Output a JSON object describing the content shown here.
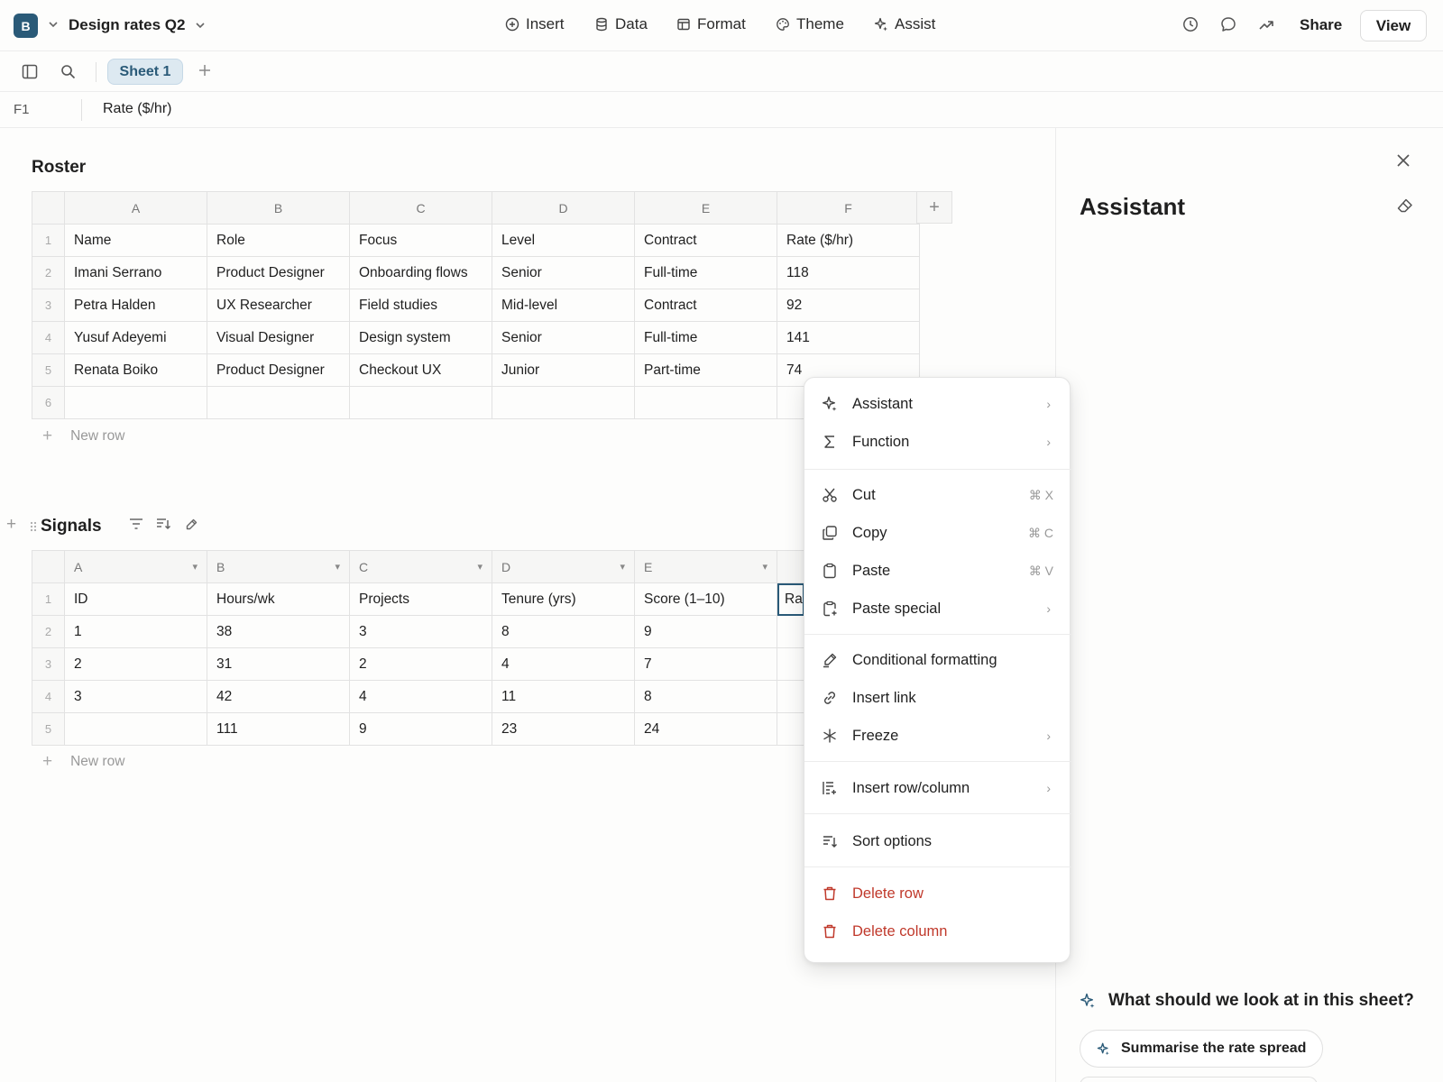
{
  "app": {
    "logo_letter": "B",
    "doc_title": "Design rates Q2"
  },
  "menus": {
    "insert": "Insert",
    "data": "Data",
    "format": "Format",
    "theme": "Theme",
    "assist": "Assist"
  },
  "toolbar": {
    "share": "Share",
    "view": "View"
  },
  "tabs": {
    "active": "Sheet 1"
  },
  "formula_bar": {
    "cell_ref": "F1",
    "value": "Rate ($/hr)"
  },
  "roster": {
    "title": "Roster",
    "columns": [
      "A",
      "B",
      "C",
      "D",
      "E",
      "F"
    ],
    "row_numbers": [
      "1",
      "2",
      "3",
      "4",
      "5",
      "6"
    ],
    "rows": [
      [
        "Name",
        "Role",
        "Focus",
        "Level",
        "Contract",
        "Rate ($/hr)"
      ],
      [
        "Imani Serrano",
        "Product Designer",
        "Onboarding flows",
        "Senior",
        "Full-time",
        "118"
      ],
      [
        "Petra Halden",
        "UX Researcher",
        "Field studies",
        "Mid-level",
        "Contract",
        "92"
      ],
      [
        "Yusuf Adeyemi",
        "Visual Designer",
        "Design system",
        "Senior",
        "Full-time",
        "141"
      ],
      [
        "Renata Boiko",
        "Product Designer",
        "Checkout UX",
        "Junior",
        "Part-time",
        "74"
      ],
      [
        "",
        "",
        "",
        "",
        "",
        ""
      ]
    ],
    "new_row": "New row"
  },
  "signals": {
    "title": "Signals",
    "columns": [
      "A",
      "B",
      "C",
      "D",
      "E"
    ],
    "row_numbers": [
      "1",
      "2",
      "3",
      "4",
      "5"
    ],
    "rows": [
      [
        "ID",
        "Hours/wk",
        "Projects",
        "Tenure (yrs)",
        "Score (1–10)",
        "Rat"
      ],
      [
        "1",
        "38",
        "3",
        "8",
        "9",
        ""
      ],
      [
        "2",
        "31",
        "2",
        "4",
        "7",
        ""
      ],
      [
        "3",
        "42",
        "4",
        "11",
        "8",
        ""
      ],
      [
        "",
        "111",
        "9",
        "23",
        "24",
        ""
      ]
    ],
    "new_row": "New row"
  },
  "context_menu": {
    "assistant": "Assistant",
    "function": "Function",
    "cut": "Cut",
    "cut_shortcut": "⌘ X",
    "copy": "Copy",
    "copy_shortcut": "⌘ C",
    "paste": "Paste",
    "paste_shortcut": "⌘ V",
    "paste_special": "Paste special",
    "conditional_formatting": "Conditional formatting",
    "insert_link": "Insert link",
    "freeze": "Freeze",
    "insert_row_column": "Insert row/column",
    "sort_options": "Sort options",
    "delete_row": "Delete row",
    "delete_column": "Delete column"
  },
  "assistant_panel": {
    "title": "Assistant",
    "question": "What should we look at in this sheet?",
    "suggestion": "Summarise the rate spread"
  },
  "colors": {
    "accent": "#2a5a78",
    "danger": "#c0392b",
    "tab_active_bg": "#dde9f1"
  }
}
